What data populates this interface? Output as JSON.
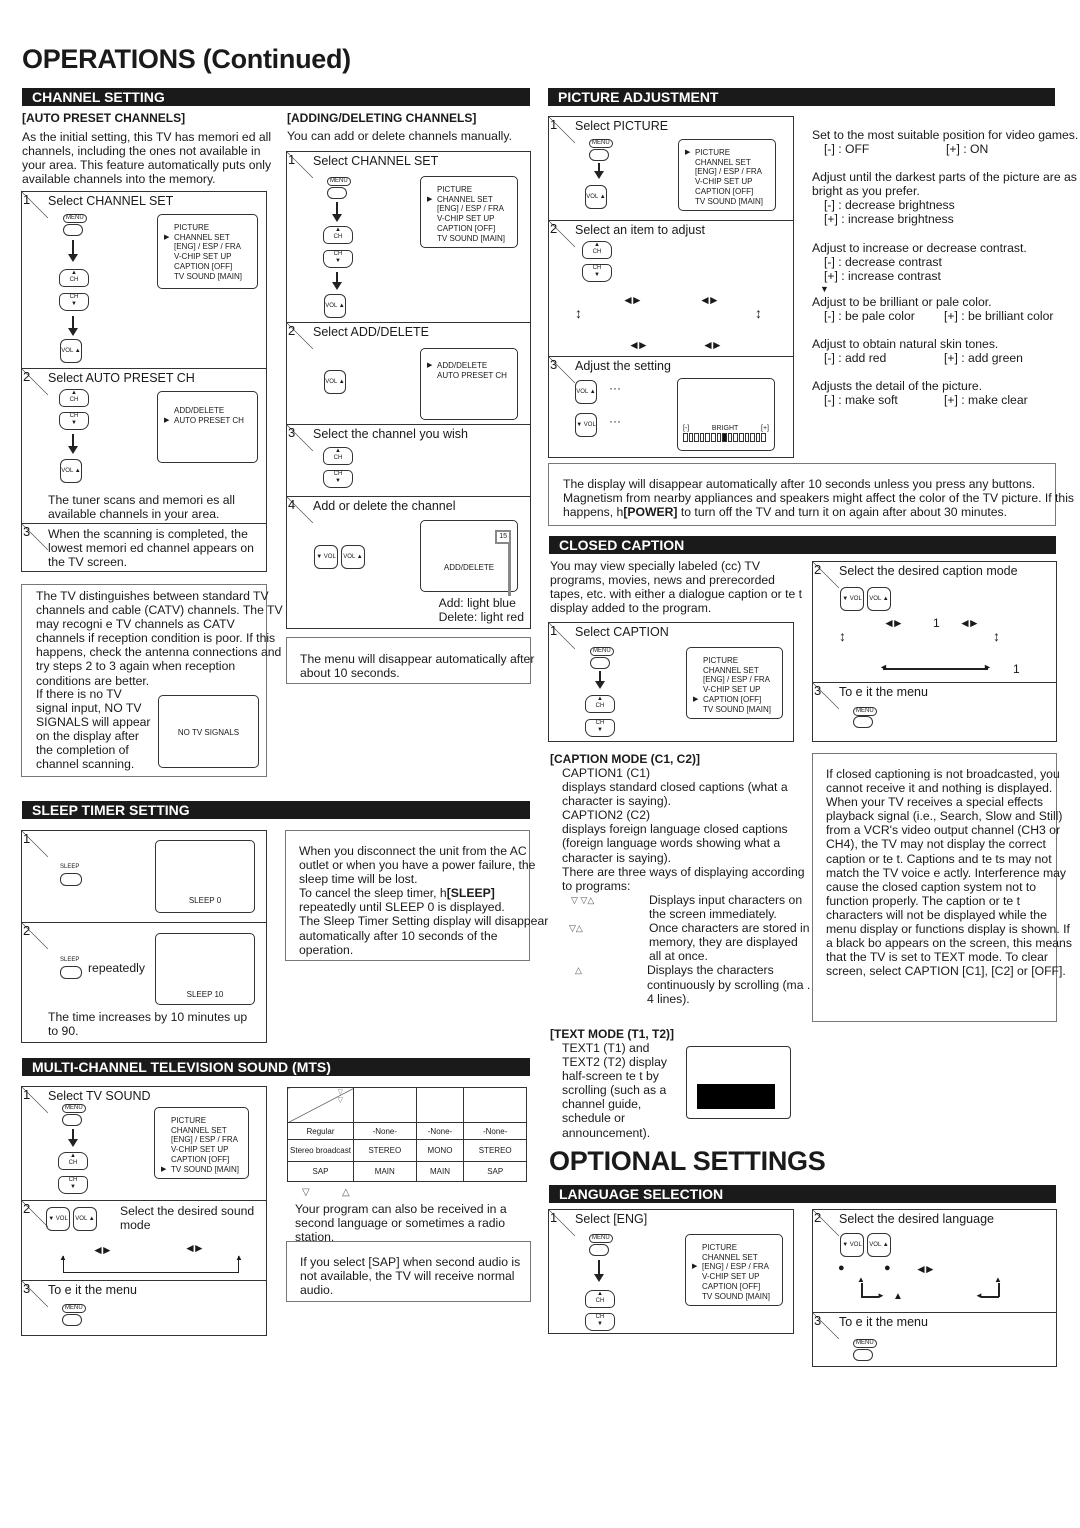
{
  "page_title": "OPERATIONS (Continued)",
  "channel_setting": {
    "header": "CHANNEL SETTING",
    "auto_preset": {
      "title": "[AUTO PRESET CHANNELS]",
      "intro": "As the initial setting, this TV has memori ed all channels, including the ones not available in your area. This feature automatically puts only available channels into the memory.",
      "steps": [
        {
          "num": "1",
          "title": "Select CHANNEL SET"
        },
        {
          "num": "2",
          "title": "Select AUTO PRESET CH",
          "note": "The tuner scans and memori es all available channels in your area."
        },
        {
          "num": "3",
          "title": "When the scanning is completed, the lowest memori ed channel appears on the TV screen."
        }
      ],
      "menu1": [
        "PICTURE",
        "CHANNEL SET",
        "[ENG] / ESP / FRA",
        "V-CHIP SET UP",
        "CAPTION [OFF]",
        "TV SOUND [MAIN]"
      ],
      "menu2": [
        "ADD/DELETE",
        "AUTO PRESET CH"
      ],
      "note_box": "The TV distinguishes between standard TV channels and cable (CATV) channels. The TV may recogni e TV channels as CATV channels if reception condition is poor. If this happens, check the antenna connections and try steps 2 to 3 again when reception conditions are better.",
      "no_signal_text": "If there is no TV signal input, NO TV SIGNALS will appear on the display after the completion of channel scanning.",
      "no_signal_osd": "NO TV SIGNALS"
    },
    "add_delete": {
      "title": "[ADDING/DELETING CHANNELS]",
      "intro": "You can add or delete channels manually.",
      "steps": [
        {
          "num": "1",
          "title": "Select CHANNEL SET"
        },
        {
          "num": "2",
          "title": "Select ADD/DELETE"
        },
        {
          "num": "3",
          "title": "Select the channel you wish"
        },
        {
          "num": "4",
          "title": "Add or delete the channel"
        }
      ],
      "channel_number": "15",
      "osd_label": "ADD/DELETE",
      "add_color_note": "Add: light blue",
      "delete_color_note": "Delete: light red",
      "note_box": "The menu will disappear automatically after about 10 seconds."
    }
  },
  "sleep_timer": {
    "header": "SLEEP TIMER SETTING",
    "button_label": "SLEEP",
    "step1_osd": "SLEEP 0",
    "step2_label": "repeatedly",
    "step2_osd": "SLEEP 10",
    "step2_note": "The time increases by 10 minutes up to 90.",
    "note_box_1": "When you disconnect the unit from the AC outlet or when you have a power failure, the sleep time will be lost.",
    "note_box_2a": "To cancel the sleep timer, h",
    "note_box_2b": "[SLEEP]",
    "note_box_2c": " repeatedly until SLEEP 0 is displayed.",
    "note_box_3": "The Sleep Timer Setting display will disappear automatically after 10 seconds of the operation."
  },
  "mts": {
    "header": "MULTI-CHANNEL TELEVISION SOUND (MTS)",
    "steps": [
      {
        "num": "1",
        "title": "Select TV SOUND"
      },
      {
        "num": "2",
        "title": "Select the desired sound mode"
      },
      {
        "num": "3",
        "title": "To e it the menu"
      }
    ],
    "menu": [
      "PICTURE",
      "CHANNEL SET",
      "[ENG] / ESP / FRA",
      "V-CHIP SET UP",
      "CAPTION [OFF]",
      "TV SOUND [MAIN]"
    ],
    "table": {
      "rows": [
        [
          "Regular",
          "-None-",
          "-None-",
          "-None-"
        ],
        [
          "Stereo broadcast",
          "STEREO",
          "MONO",
          "STEREO"
        ],
        [
          "SAP",
          "MAIN",
          "MAIN",
          "SAP"
        ]
      ]
    },
    "note": "Your program can also be received in a second language or sometimes a radio station.",
    "note_box": "If you select [SAP] when second audio is not available, the TV will receive normal audio."
  },
  "picture_adjustment": {
    "header": "PICTURE ADJUSTMENT",
    "steps": [
      {
        "num": "1",
        "title": "Select PICTURE"
      },
      {
        "num": "2",
        "title": "Select an item to adjust"
      },
      {
        "num": "3",
        "title": "Adjust the setting"
      }
    ],
    "menu": [
      "PICTURE",
      "CHANNEL SET",
      "[ENG] / ESP / FRA",
      "V-CHIP SET UP",
      "CAPTION  [OFF]",
      "TV SOUND [MAIN]"
    ],
    "osd_minus": "[-]",
    "osd_label": "BRIGHT",
    "osd_plus": "[+]",
    "bright_level": 0.5,
    "descriptions": [
      {
        "text": "Set to the most suitable position for video games.",
        "minus": "[-] : OFF",
        "plus": "[+] : ON"
      },
      {
        "text": "Adjust until the darkest parts of the picture are as bright as you prefer.",
        "minus": "[-] : decrease brightness",
        "plus": "[+] : increase brightness"
      },
      {
        "text": "Adjust to increase or decrease contrast.",
        "minus": "[-] : decrease contrast",
        "plus": "[+] : increase contrast"
      },
      {
        "text": "Adjust to be brilliant or pale color.",
        "minus": "[-] : be pale color",
        "plus": "[+] : be brilliant color"
      },
      {
        "text": "Adjust to obtain natural skin tones.",
        "minus": "[-] : add red",
        "plus": "[+] : add green"
      },
      {
        "text": "Adjusts the detail of the picture.",
        "minus": "[-] : make soft",
        "plus": "[+] : make clear"
      }
    ],
    "note_a": "The display will disappear automatically after 10 seconds unless you press any buttons. Magnetism from nearby appliances and speakers might affect the color of the TV picture. If this happens, h",
    "note_b": "[POWER]",
    "note_c": " to turn off the TV and turn it on again after about 30 minutes."
  },
  "closed_caption": {
    "header": "CLOSED CAPTION",
    "intro": "You may view specially labeled (cc) TV programs, movies, news and prerecorded tapes, etc. with either a dialogue caption or te t display added to the program.",
    "steps": [
      {
        "num": "1",
        "title": "Select CAPTION"
      },
      {
        "num": "2",
        "title": "Select the desired caption mode"
      },
      {
        "num": "3",
        "title": "To e it the menu"
      }
    ],
    "menu": [
      "PICTURE",
      "CHANNEL SET",
      "[ENG] / ESP / FRA",
      "V-CHIP SET UP",
      "CAPTION [OFF]",
      "TV SOUND [MAIN]"
    ],
    "mode_label_1": "1",
    "mode_label_2": "1",
    "caption_mode": {
      "title": "[CAPTION MODE (C1, C2)]",
      "c1": "CAPTION1 (C1)",
      "c1_desc": "displays standard closed captions (what a character is saying).",
      "c2": "CAPTION2 (C2)",
      "c2_desc": "displays foreign language closed captions (foreign language words showing what a character is saying).",
      "ways": "There are three ways of displaying according to programs:",
      "way1": "Displays input characters on the screen immediately.",
      "way2": "Once characters are stored in memory, they are displayed all at once.",
      "way3": "Displays the characters continuously by scrolling (ma . 4 lines)."
    },
    "text_mode": {
      "title": "[TEXT MODE (T1, T2)]",
      "desc": "TEXT1 (T1) and TEXT2 (T2) display half-screen te t by scrolling (such as a channel guide, schedule or announcement)."
    },
    "note_box": "If closed captioning is not broadcasted, you cannot receive it and nothing is displayed. When your TV receives a special effects playback signal (i.e., Search, Slow and Still) from a VCR's video output channel (CH3 or CH4), the TV may not display the correct caption or te t. Captions and te ts may not match the TV voice e actly. Interference may cause the closed caption system not to function properly. The caption or te t characters will not be displayed while the menu display or functions display is shown. If a black bo appears on the screen, this means that the TV is set to TEXT mode. To clear screen, select CAPTION [C1], [C2] or [OFF]."
  },
  "optional_settings": {
    "title": "OPTIONAL SETTINGS",
    "language": {
      "header": "LANGUAGE SELECTION",
      "steps": [
        {
          "num": "1",
          "title": "Select [ENG]"
        },
        {
          "num": "2",
          "title": "Select the desired language"
        },
        {
          "num": "3",
          "title": "To e it the menu"
        }
      ],
      "menu": [
        "PICTURE",
        "CHANNEL SET",
        "[ENG] / ESP / FRA",
        "V-CHIP SET UP",
        "CAPTION [OFF]",
        "TV SOUND [MAIN]"
      ]
    }
  },
  "buttons": {
    "menu": "MENU",
    "ch": "CH",
    "vol": "VOL",
    "sleep": "SLEEP"
  }
}
